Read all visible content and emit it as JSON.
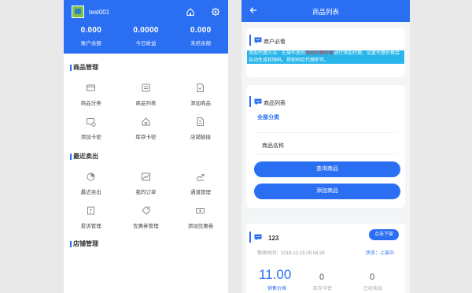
{
  "left": {
    "username": "test001",
    "stats": [
      {
        "value": "0.000",
        "label": "账户余额"
      },
      {
        "value": "0.0000",
        "label": "今日收益"
      },
      {
        "value": "0.000",
        "label": "未结余额"
      }
    ],
    "sections": [
      {
        "title": "商品管理",
        "items": [
          {
            "label": "商品分类",
            "icon": "card-icon"
          },
          {
            "label": "商品列表",
            "icon": "list-icon"
          },
          {
            "label": "添加商品",
            "icon": "add-doc-icon"
          },
          {
            "label": "添加卡密",
            "icon": "add-card-icon"
          },
          {
            "label": "库存卡密",
            "icon": "home-icon"
          },
          {
            "label": "店铺链接",
            "icon": "link-doc-icon"
          }
        ]
      },
      {
        "title": "最近卖出",
        "items": [
          {
            "label": "最近卖出",
            "icon": "pie-icon"
          },
          {
            "label": "我的订单",
            "icon": "chart-icon"
          },
          {
            "label": "通道管理",
            "icon": "trend-icon"
          },
          {
            "label": "投诉管理",
            "icon": "complaint-icon"
          },
          {
            "label": "优惠券管理",
            "icon": "tag-icon"
          },
          {
            "label": "添加优惠卷",
            "icon": "ticket-icon"
          }
        ]
      },
      {
        "title": "店铺管理",
        "items": []
      }
    ]
  },
  "right": {
    "title": "商品列表",
    "notice_card": {
      "title": "商户必看",
      "text_before": "添加代理方法：在操作里的",
      "text_highlight": "添加代理价格",
      "text_after": "进行添加代理，设置代理价格会自动生成权限码，授权码给代理即可。"
    },
    "list_card": {
      "title": "商品列表",
      "category": "全部分类",
      "name_field": "商品名称",
      "query_button": "查询商品",
      "add_button": "添加商品"
    },
    "product": {
      "name": "123",
      "action_button": "点击下架",
      "modified_time": "修改时间：2019-12-15 00:04:28",
      "status": "状态：上架中",
      "price": "11.00",
      "price_label": "销售价格",
      "stock": "0",
      "stock_label": "库存卡密",
      "sold": "0",
      "sold_label": "已经卖出"
    },
    "accent": "#2a6ef2"
  }
}
